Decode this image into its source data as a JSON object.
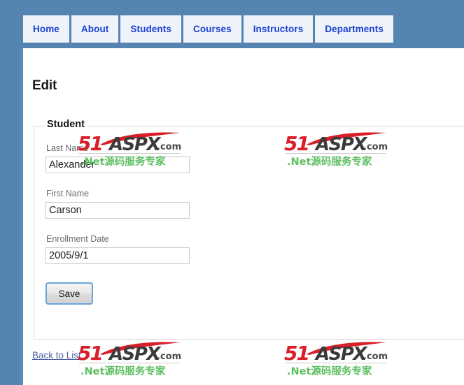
{
  "nav": {
    "items": [
      {
        "label": "Home",
        "name": "nav-tab-home"
      },
      {
        "label": "About",
        "name": "nav-tab-about"
      },
      {
        "label": "Students",
        "name": "nav-tab-students"
      },
      {
        "label": "Courses",
        "name": "nav-tab-courses"
      },
      {
        "label": "Instructors",
        "name": "nav-tab-instructors"
      },
      {
        "label": "Departments",
        "name": "nav-tab-departments"
      }
    ]
  },
  "page": {
    "title": "Edit",
    "fieldset_legend": "Student",
    "back_link": "Back to List"
  },
  "form": {
    "fields": [
      {
        "label": "Last Name",
        "value": "Alexander",
        "placeholder": ""
      },
      {
        "label": "First Name",
        "value": "Carson",
        "placeholder": ""
      },
      {
        "label": "Enrollment Date",
        "value": "2005/9/1",
        "placeholder": ""
      }
    ],
    "save_label": "Save"
  },
  "watermark": {
    "number": "51",
    "brand": "ASPX",
    "tld": ".com",
    "subtitle": ".Net源码服务专家"
  },
  "colors": {
    "header_blue": "#5684b0",
    "tab_bg": "#eef3f9",
    "tab_text": "#1b3fd4",
    "link": "#4a5f9e",
    "save_border": "#6aa4dc",
    "watermark_red": "#d9202a",
    "watermark_green": "#5ebf62",
    "label_gray": "#6d6d6d"
  }
}
